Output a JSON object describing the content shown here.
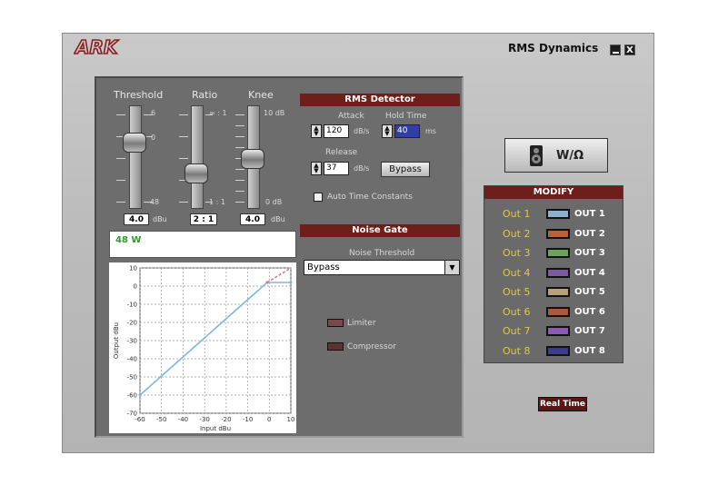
{
  "window": {
    "title": "RMS Dynamics",
    "minimize_label": "",
    "close_label": "X",
    "logo_text": "ARK"
  },
  "faders": {
    "threshold": {
      "label": "Threshold",
      "top_tick": "6",
      "mid_tick": "0",
      "bottom_tick": "-48",
      "value": "4.0",
      "unit": "dBu"
    },
    "ratio": {
      "label": "Ratio",
      "top_tick": "∞ : 1",
      "bottom_tick": "1 : 1",
      "value": "2 : 1"
    },
    "knee": {
      "label": "Knee",
      "top_tick": "10 dB",
      "bottom_tick": "0 dB",
      "value": "4.0",
      "unit": "dBu"
    }
  },
  "display_text": "48 W",
  "rms_detector": {
    "header": "RMS Detector",
    "attack_label": "Attack",
    "attack_value": "120",
    "attack_unit": "dB/s",
    "hold_label": "Hold Time",
    "hold_value": "40",
    "hold_unit": "ms",
    "release_label": "Release",
    "release_value": "37",
    "release_unit": "dB/s",
    "bypass_label": "Bypass",
    "auto_label": "Auto Time Constants"
  },
  "noise_gate": {
    "header": "Noise Gate",
    "threshold_label": "Noise Threshold",
    "selected": "Bypass"
  },
  "modes": {
    "limiter": "Limiter",
    "compressor": "Compressor"
  },
  "speaker_button": "W/Ω",
  "modify": {
    "header": "MODIFY",
    "rows": [
      {
        "label": "Out 1",
        "name": "OUT 1",
        "color": "#8fb0d0"
      },
      {
        "label": "Out 2",
        "name": "OUT 2",
        "color": "#b0643c"
      },
      {
        "label": "Out 3",
        "name": "OUT 3",
        "color": "#6ea25a"
      },
      {
        "label": "Out 4",
        "name": "OUT 4",
        "color": "#7d5aa0"
      },
      {
        "label": "Out 5",
        "name": "OUT 5",
        "color": "#b8a07a"
      },
      {
        "label": "Out 6",
        "name": "OUT 6",
        "color": "#a55a3c"
      },
      {
        "label": "Out 7",
        "name": "OUT 7",
        "color": "#8c5ab4"
      },
      {
        "label": "Out 8",
        "name": "OUT 8",
        "color": "#3c3c8c"
      }
    ]
  },
  "realtime_label": "Real Time",
  "chart_data": {
    "type": "line",
    "xlabel": "Input dBu",
    "ylabel": "Output dBu",
    "xlim": [
      -60,
      10
    ],
    "ylim": [
      -70,
      10
    ],
    "x_ticks": [
      "-60",
      "-50",
      "-40",
      "-30",
      "-20",
      "-10",
      "0",
      "10"
    ],
    "y_ticks": [
      "10",
      "0",
      "-10",
      "-20",
      "-30",
      "-40",
      "-50",
      "-60",
      "-70"
    ],
    "grid": true,
    "series": [
      {
        "color": "#7fb6e0",
        "x": [
          -60,
          -1,
          10
        ],
        "y": [
          -60,
          2,
          2
        ]
      },
      {
        "color": "#d08080",
        "x": [
          -1,
          10
        ],
        "y": [
          2,
          12
        ]
      }
    ]
  }
}
